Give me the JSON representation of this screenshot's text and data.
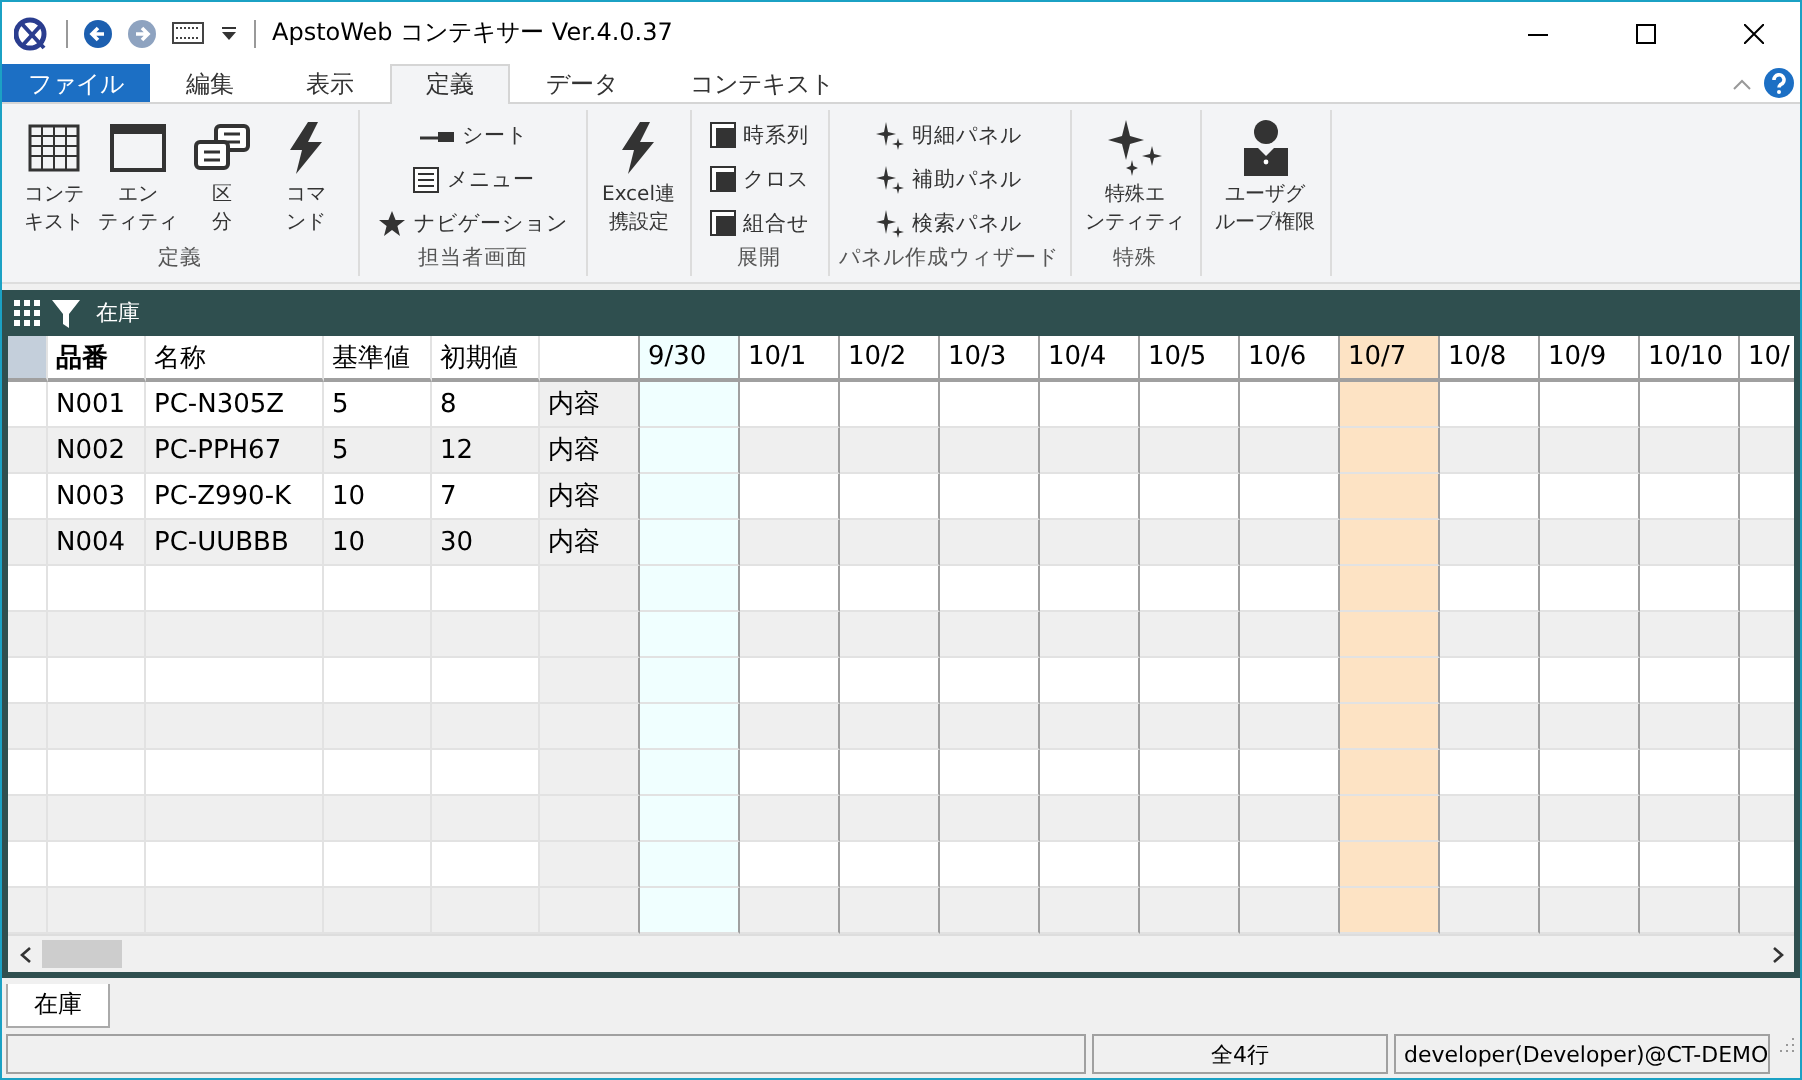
{
  "window": {
    "title": "ApstoWeb コンテキサー Ver.4.0.37"
  },
  "ribbon": {
    "tabs": [
      {
        "label": "ファイル",
        "kind": "file",
        "selected": false
      },
      {
        "label": "編集",
        "kind": "tab",
        "selected": false
      },
      {
        "label": "表示",
        "kind": "tab",
        "selected": false
      },
      {
        "label": "定義",
        "kind": "tab",
        "selected": true
      },
      {
        "label": "データ",
        "kind": "tab",
        "selected": false
      },
      {
        "label": "コンテキスト",
        "kind": "tab",
        "selected": false
      }
    ],
    "groups": [
      {
        "label": "定義",
        "items": [
          {
            "kind": "large",
            "lines": [
              "コンテ",
              "キスト"
            ]
          },
          {
            "kind": "large",
            "lines": [
              "エン",
              "ティティ"
            ]
          },
          {
            "kind": "large",
            "lines": [
              "区",
              "分"
            ]
          },
          {
            "kind": "large",
            "lines": [
              "コマ",
              "ンド"
            ]
          }
        ]
      },
      {
        "label": "担当者画面",
        "items": [
          {
            "kind": "small",
            "label": "シート"
          },
          {
            "kind": "small",
            "label": "メニュー"
          },
          {
            "kind": "small",
            "label": "ナビゲーション"
          }
        ]
      },
      {
        "items": [
          {
            "kind": "large",
            "lines": [
              "Excel連",
              "携設定"
            ]
          }
        ]
      },
      {
        "label": "展開",
        "items": [
          {
            "kind": "small",
            "label": "時系列"
          },
          {
            "kind": "small",
            "label": "クロス"
          },
          {
            "kind": "small",
            "label": "組合せ"
          }
        ]
      },
      {
        "label": "パネル作成ウィザード",
        "items": [
          {
            "kind": "small",
            "label": "明細パネル"
          },
          {
            "kind": "small",
            "label": "補助パネル"
          },
          {
            "kind": "small",
            "label": "検索パネル"
          }
        ]
      },
      {
        "label": "特殊",
        "items": [
          {
            "kind": "large",
            "lines": [
              "特殊エ",
              "ンティティ"
            ]
          }
        ]
      },
      {
        "items": [
          {
            "kind": "large",
            "lines": [
              "ユーザグ",
              "ループ権限"
            ]
          }
        ]
      }
    ]
  },
  "sheet": {
    "title": "在庫",
    "columns": [
      {
        "label": "品番",
        "kind": "key"
      },
      {
        "label": "名称",
        "kind": "text"
      },
      {
        "label": "基準値",
        "kind": "text"
      },
      {
        "label": "初期値",
        "kind": "text"
      },
      {
        "kind": "memo"
      },
      {
        "label": "9/30",
        "kind": "date",
        "color": "#f0ffff"
      },
      {
        "label": "10/1",
        "kind": "date",
        "color": "#ffffff"
      },
      {
        "label": "10/2",
        "kind": "date",
        "color": "#ffffff"
      },
      {
        "label": "10/3",
        "kind": "date",
        "color": "#ffffff"
      },
      {
        "label": "10/4",
        "kind": "date",
        "color": "#ffffff"
      },
      {
        "label": "10/5",
        "kind": "date",
        "color": "#ffffff"
      },
      {
        "label": "10/6",
        "kind": "date",
        "color": "#ffffff"
      },
      {
        "label": "10/7",
        "kind": "date",
        "color": "#fde3c4"
      },
      {
        "label": "10/8",
        "kind": "date",
        "color": "#ffffff"
      },
      {
        "label": "10/9",
        "kind": "date",
        "color": "#ffffff"
      },
      {
        "label": "10/10",
        "kind": "date",
        "color": "#ffffff"
      },
      {
        "label": "10/",
        "kind": "date",
        "color": "#ffffff"
      }
    ],
    "rows": [
      {
        "cells": [
          "N001",
          "PC-N305Z",
          "5",
          "8",
          "内容"
        ]
      },
      {
        "cells": [
          "N002",
          "PC-PPH67",
          "5",
          "12",
          "内容"
        ]
      },
      {
        "cells": [
          "N003",
          "PC-Z990-K",
          "10",
          "7",
          "内容"
        ]
      },
      {
        "cells": [
          "N004",
          "PC-UUBBB",
          "10",
          "30",
          "内容"
        ]
      }
    ]
  },
  "sheet_tabs": [
    {
      "label": "在庫",
      "selected": true
    }
  ],
  "status_bar": {
    "row_count": "全4行",
    "user": "developer(Developer)@CT-DEMO"
  }
}
